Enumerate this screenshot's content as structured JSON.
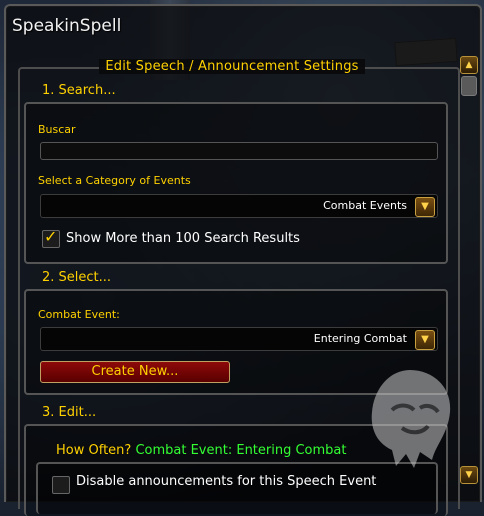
{
  "window": {
    "title": "SpeakinSpell"
  },
  "group": {
    "title": "Edit Speech / Announcement Settings"
  },
  "search": {
    "heading": "1. Search...",
    "label": "Buscar",
    "value": "",
    "category_label": "Select a Category of Events",
    "category_value": "Combat Events",
    "show_more_label": "Show More than 100 Search Results",
    "show_more_checked": true
  },
  "select": {
    "heading": "2. Select...",
    "event_label": "Combat Event:",
    "event_value": "Entering Combat",
    "create_label": "Create New..."
  },
  "edit": {
    "heading": "3. Edit...",
    "how_often_prefix": "How Often?",
    "how_often_value": "Combat Event: Entering Combat",
    "disable_label": "Disable announcements for this Speech Event",
    "disable_checked": false
  },
  "icons": {
    "dropdown": "chevron-down-icon",
    "scroll_up": "scroll-up-icon",
    "scroll_down": "scroll-down-icon",
    "check": "checkmark-icon",
    "emblem": "lion-emblem-icon"
  }
}
